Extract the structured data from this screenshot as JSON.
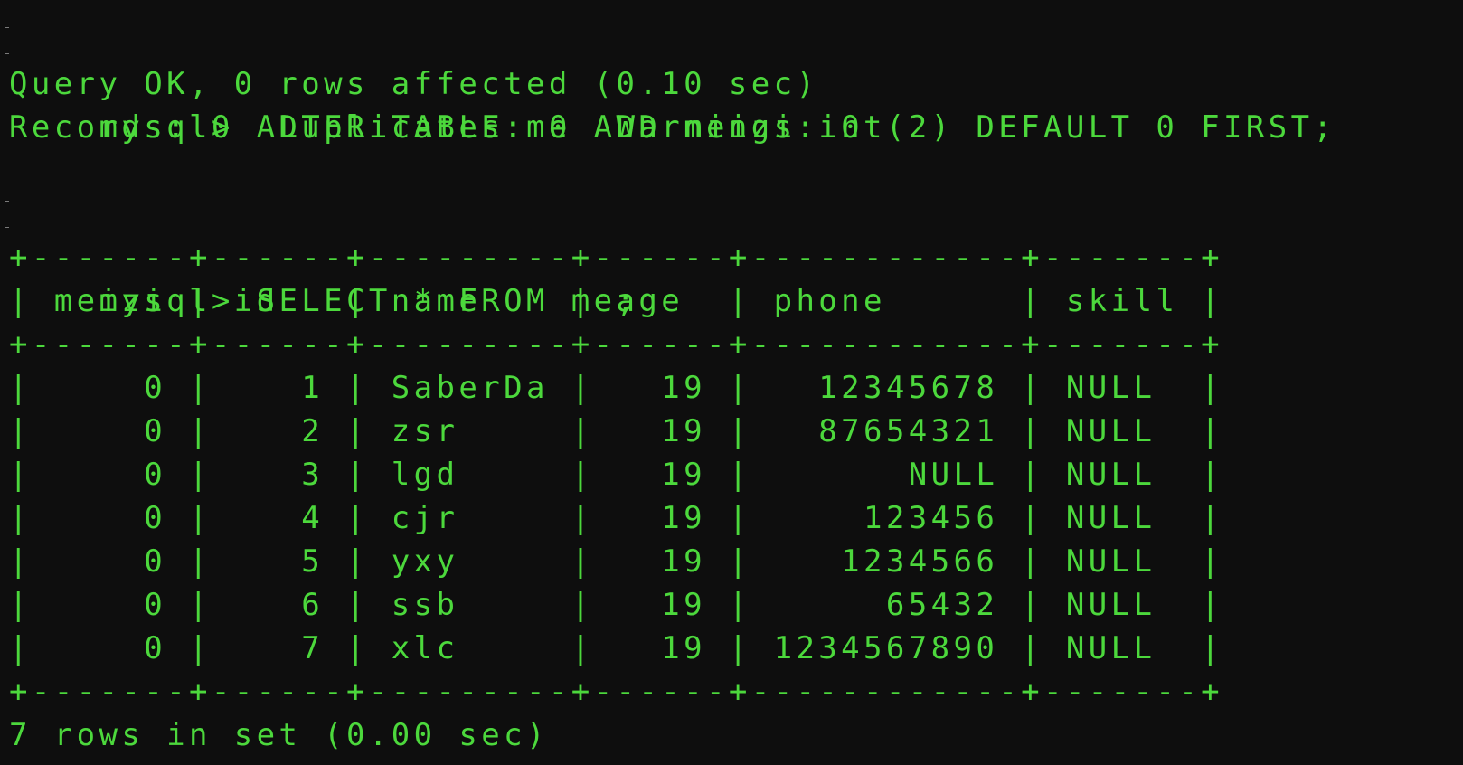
{
  "colors": {
    "background": "#0e0e0e",
    "text": "#4cd83c"
  },
  "session": {
    "command_1": "mysql> ALTER TABLE me ADD meizi int(2) DEFAULT 0 FIRST;",
    "result_1": "Query OK, 0 rows affected (0.10 sec)",
    "records_1": "Records: 0  Duplicates: 0  Warnings: 0",
    "command_2": "mysql> SELECT * FROM me;",
    "table_lines": [
      "+-------+------+---------+------+------------+-------+",
      "| meizi | id   | name    | age  | phone      | skill |",
      "+-------+------+---------+------+------------+-------+",
      "|     0 |    1 | SaberDa |   19 |   12345678 | NULL  |",
      "|     0 |    2 | zsr     |   19 |   87654321 | NULL  |",
      "|     0 |    3 | lgd     |   19 |       NULL | NULL  |",
      "|     0 |    4 | cjr     |   19 |     123456 | NULL  |",
      "|     0 |    5 | yxy     |   19 |    1234566 | NULL  |",
      "|     0 |    6 | ssb     |   19 |      65432 | NULL  |",
      "|     0 |    7 | xlc     |   19 | 1234567890 | NULL  |",
      "+-------+------+---------+------+------------+-------+"
    ],
    "footer": "7 rows in set (0.00 sec)"
  }
}
